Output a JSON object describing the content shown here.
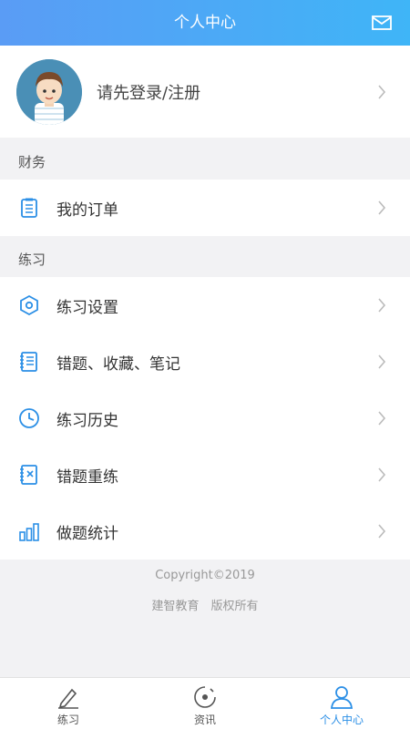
{
  "header": {
    "title": "个人中心",
    "icon": "mail-icon"
  },
  "profile": {
    "login_text": "请先登录/注册"
  },
  "sections": {
    "finance": {
      "label": "财务",
      "items": [
        {
          "label": "我的订单",
          "icon": "order-list-icon"
        }
      ]
    },
    "practice": {
      "label": "练习",
      "items": [
        {
          "label": "练习设置",
          "icon": "settings-hex-icon"
        },
        {
          "label": "错题、收藏、笔记",
          "icon": "notebook-icon"
        },
        {
          "label": "练习历史",
          "icon": "clock-icon"
        },
        {
          "label": "错题重练",
          "icon": "retry-notebook-icon"
        },
        {
          "label": "做题统计",
          "icon": "bar-stats-icon"
        }
      ]
    }
  },
  "footer": {
    "copyright": "Copyright©2019",
    "company": "建智教育　版权所有"
  },
  "tabbar": {
    "items": [
      {
        "label": "练习",
        "icon": "pencil-icon",
        "active": false
      },
      {
        "label": "资讯",
        "icon": "news-icon",
        "active": false
      },
      {
        "label": "个人中心",
        "icon": "person-icon",
        "active": true
      }
    ]
  },
  "colors": {
    "accent": "#2b8fe6",
    "header_start": "#5a9cf5",
    "header_end": "#3fb5f7",
    "icon_blue": "#2b8fe6"
  }
}
